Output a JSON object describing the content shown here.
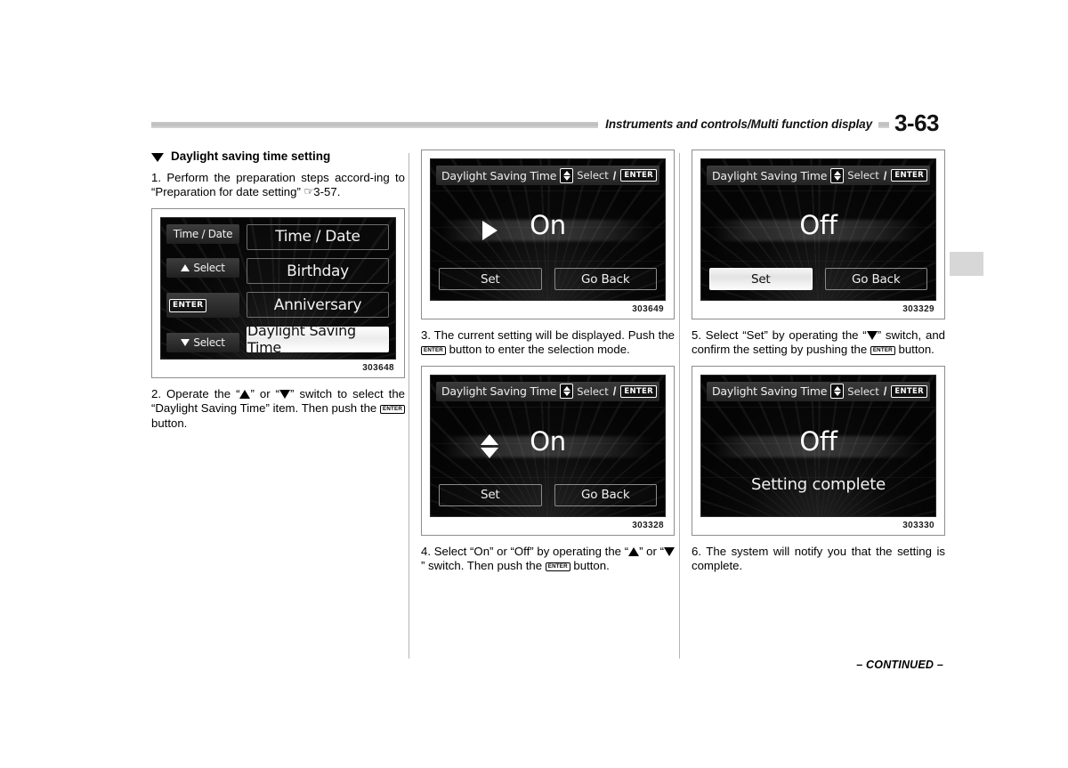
{
  "header": {
    "title": "Instruments and controls/Multi function display",
    "page_number": "3-63"
  },
  "footer": {
    "continued": "– CONTINUED –"
  },
  "section": {
    "heading": "Daylight saving time setting",
    "marker_icon": "triangle-down-icon"
  },
  "steps": {
    "step1": {
      "pre": "1.  Perform the preparation steps accord-ing to “Preparation for date setting” ",
      "hand_icon": "☞",
      "ref": "3-57."
    },
    "step2": {
      "p1": "2.  Operate the “",
      "p2": "” or “",
      "p3": "” switch to select the “Daylight Saving Time” item. Then push the ",
      "enter_label": "ENTER",
      "p4": " button."
    },
    "step3": {
      "p1": "3.  The current setting will be displayed. Push the ",
      "enter_label": "ENTER",
      "p2": " button to enter the selection mode."
    },
    "step4": {
      "p1": "4.  Select “On” or “Off” by operating the “",
      "p2": "” or “",
      "p3": "” switch. Then push the ",
      "enter_label": "ENTER",
      "p4": " button."
    },
    "step5": {
      "p1": "5.  Select “Set” by operating the “",
      "p2": "” switch, and confirm the setting by pushing the ",
      "enter_label": "ENTER",
      "p3": " button."
    },
    "step6": {
      "p1": "6.  The system will notify you that the setting is complete."
    }
  },
  "figures": {
    "menu": {
      "id": "303648",
      "left_buttons": [
        {
          "label": "Time / Date",
          "icon": "none"
        },
        {
          "label": "Select",
          "icon": "triangle-up-icon"
        },
        {
          "label": "ENTER",
          "icon": "enter-chip-icon"
        },
        {
          "label": "Select",
          "icon": "triangle-down-icon"
        }
      ],
      "items": [
        {
          "label": "Time / Date",
          "selected": false
        },
        {
          "label": "Birthday",
          "selected": false
        },
        {
          "label": "Anniversary",
          "selected": false
        },
        {
          "label": "Daylight Saving Time",
          "selected": true
        }
      ]
    },
    "on_current": {
      "id": "303649",
      "title": "Daylight Saving Time",
      "select_label": "Select",
      "slash": "/",
      "enter_label": "ENTER",
      "value": "On",
      "cursor": "triangle-right-icon",
      "buttons": [
        {
          "label": "Set",
          "selected": false
        },
        {
          "label": "Go Back",
          "selected": false
        }
      ]
    },
    "on_selecting": {
      "id": "303328",
      "title": "Daylight Saving Time",
      "select_label": "Select",
      "slash": "/",
      "enter_label": "ENTER",
      "value": "On",
      "cursor": "triangle-up-down-icon",
      "buttons": [
        {
          "label": "Set",
          "selected": false
        },
        {
          "label": "Go Back",
          "selected": false
        }
      ]
    },
    "off_set": {
      "id": "303329",
      "title": "Daylight Saving Time",
      "select_label": "Select",
      "slash": "/",
      "enter_label": "ENTER",
      "value": "Off",
      "cursor": "none",
      "buttons": [
        {
          "label": "Set",
          "selected": true
        },
        {
          "label": "Go Back",
          "selected": false
        }
      ]
    },
    "off_complete": {
      "id": "303330",
      "title": "Daylight Saving Time",
      "select_label": "Select",
      "slash": "/",
      "enter_label": "ENTER",
      "value": "Off",
      "message": "Setting complete",
      "cursor": "none"
    }
  },
  "colors": {
    "screen_bg": "#040404",
    "rule_gray": "#c9c9c9",
    "tab_gray": "#d7d7d7",
    "text": "#000000"
  }
}
